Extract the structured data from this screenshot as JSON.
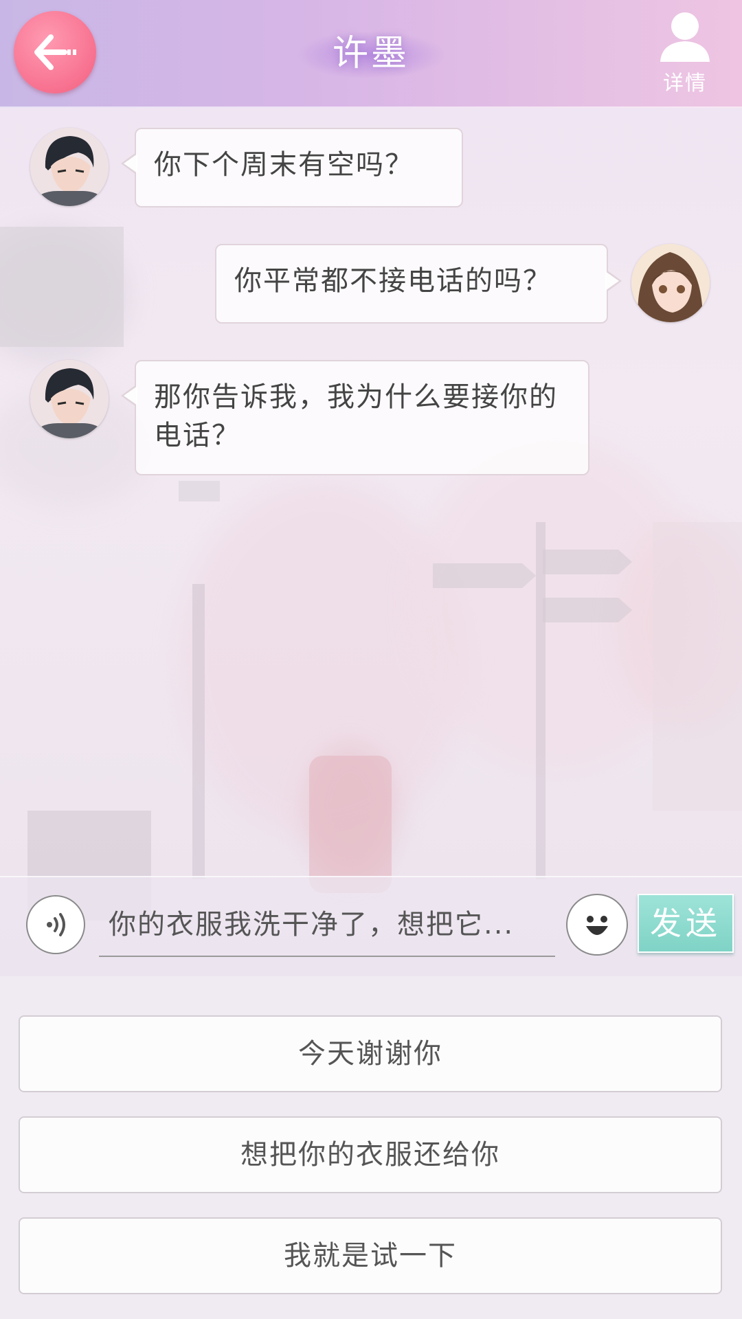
{
  "header": {
    "title": "许墨",
    "detail_label": "详情"
  },
  "messages": [
    {
      "side": "left",
      "sender": "许墨",
      "text": "你下个周末有空吗？"
    },
    {
      "side": "right",
      "sender": "me",
      "text": "你平常都不接电话的吗？"
    },
    {
      "side": "left",
      "sender": "许墨",
      "text": "那你告诉我，我为什么要接你的电话？"
    }
  ],
  "composer": {
    "draft_text": "你的衣服我洗干净了，想把它...",
    "send_label": "发送"
  },
  "options": [
    {
      "label": "今天谢谢你"
    },
    {
      "label": "想把你的衣服还给你"
    },
    {
      "label": "我就是试一下"
    }
  ],
  "colors": {
    "header_gradient_start": "#c8b7e6",
    "header_gradient_end": "#eec4e2",
    "back_button": "#f7718f",
    "send_button": "#7fd3c6"
  },
  "icons": {
    "back": "arrow-left-icon",
    "detail": "person-icon",
    "voice": "voice-wave-icon",
    "emoji": "smiley-face-icon"
  }
}
